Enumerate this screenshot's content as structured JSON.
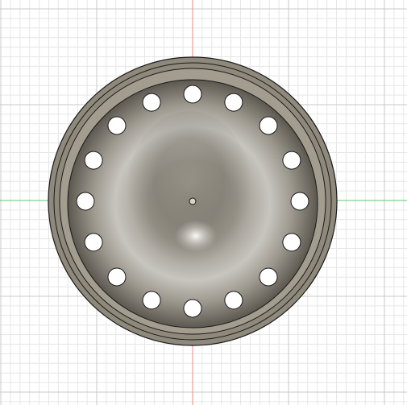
{
  "viewport": {
    "background": "#ffffff",
    "grid_minor_color": "#e6e6e6",
    "grid_major_color": "#c9c9c9",
    "axis_x_color": "#5fc46a",
    "axis_y_color": "#f08a8a"
  },
  "model": {
    "name": "",
    "rim_color": "#8f897c",
    "rim_inner_color": "#a39d90",
    "dish_light": "#c9c7c2",
    "dish_mid": "#a9a49a",
    "dish_dark": "#5e5a52",
    "hole_color": "#ffffff",
    "hole_count": 16,
    "center_pin_icon": "center-pin-icon"
  }
}
